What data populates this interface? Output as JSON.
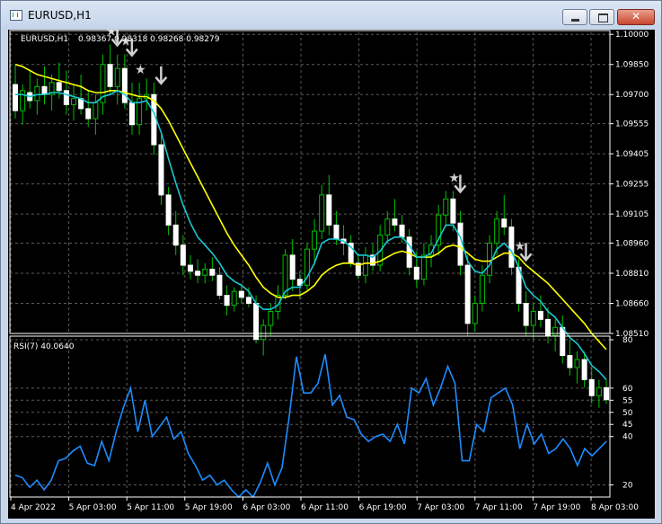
{
  "window": {
    "title": "EURUSD,H1",
    "close_glyph": "✕",
    "icons": [
      "chart-window-icon",
      "minimize-icon",
      "maximize-icon",
      "close-icon"
    ]
  },
  "colors": {
    "background": "#000000",
    "grid": "#5a5a5a",
    "bull": "#00c000",
    "ma_fast": "#19c8d2",
    "ma_slow": "#ffff00",
    "rsi": "#1e8cff",
    "arrow": "#d0d0d0",
    "text": "#ffffff"
  },
  "symbol_info": {
    "label": "EURUSD,H1",
    "values": "0.98367 0.98318 0.98268 0.98279"
  },
  "price_axis": {
    "ticks": [
      "1.10000",
      "1.09850",
      "1.09700",
      "1.09555",
      "1.09405",
      "1.09255",
      "1.09105",
      "1.08960",
      "1.08810",
      "1.08660",
      "1.08510"
    ]
  },
  "rsi_label": "RSI(7) 40.0640",
  "rsi_axis": {
    "ticks": [
      "80",
      "60",
      "55",
      "50",
      "45",
      "40",
      "20"
    ]
  },
  "time_axis": {
    "ticks": [
      "4 Apr 2022",
      "5 Apr 03:00",
      "5 Apr 11:00",
      "5 Apr 19:00",
      "6 Apr 03:00",
      "6 Apr 11:00",
      "6 Apr 19:00",
      "7 Apr 03:00",
      "7 Apr 11:00",
      "7 Apr 19:00",
      "8 Apr 03:00"
    ]
  },
  "chart_data": [
    {
      "type": "candlestick",
      "title": "EURUSD,H1",
      "x_ticks": [
        "4 Apr 2022",
        "5 Apr 03:00",
        "5 Apr 11:00",
        "5 Apr 19:00",
        "6 Apr 03:00",
        "6 Apr 11:00",
        "6 Apr 19:00",
        "7 Apr 03:00",
        "7 Apr 11:00",
        "7 Apr 19:00",
        "8 Apr 03:00"
      ],
      "ylim": [
        1.0851,
        1.1001
      ],
      "grid": true,
      "series": [
        {
          "ohlc": [
            [
              1.0975,
              1.0985,
              1.0958,
              1.0962
            ],
            [
              1.0962,
              1.0975,
              1.0955,
              1.0972
            ],
            [
              1.0971,
              1.0982,
              1.0963,
              1.0967
            ],
            [
              1.0967,
              1.0978,
              1.096,
              1.0974
            ],
            [
              1.0974,
              1.0984,
              1.0965,
              1.097
            ],
            [
              1.097,
              1.098,
              1.0962,
              1.0976
            ],
            [
              1.0976,
              1.0986,
              1.0968,
              1.0972
            ],
            [
              1.0972,
              1.0982,
              1.096,
              1.0965
            ],
            [
              1.0965,
              1.0975,
              1.0957,
              1.0968
            ],
            [
              1.0968,
              1.098,
              1.096,
              1.0963
            ],
            [
              1.0963,
              1.0972,
              1.0954,
              1.0958
            ],
            [
              1.0958,
              1.097,
              1.095,
              1.0966
            ],
            [
              1.0966,
              1.099,
              1.096,
              1.0985
            ],
            [
              1.0985,
              1.0995,
              1.097,
              1.0974
            ],
            [
              1.0974,
              1.099,
              1.0965,
              1.0983
            ],
            [
              1.0983,
              1.099,
              1.0963,
              1.0966
            ],
            [
              1.0966,
              1.0976,
              1.095,
              1.0955
            ],
            [
              1.0955,
              1.0976,
              1.095,
              1.0968
            ],
            [
              1.0968,
              1.0978,
              1.0962,
              1.097
            ],
            [
              1.097,
              1.0976,
              1.094,
              1.0945
            ],
            [
              1.0945,
              1.095,
              1.0915,
              1.092
            ],
            [
              1.092,
              1.0924,
              1.09,
              1.0905
            ],
            [
              1.0905,
              1.0912,
              1.089,
              1.0895
            ],
            [
              1.0895,
              1.09,
              1.088,
              1.0885
            ],
            [
              1.0885,
              1.089,
              1.0878,
              1.0882
            ],
            [
              1.0882,
              1.0888,
              1.0876,
              1.088
            ],
            [
              1.088,
              1.0886,
              1.0876,
              1.0883
            ],
            [
              1.0883,
              1.0889,
              1.0877,
              1.088
            ],
            [
              1.088,
              1.0884,
              1.0868,
              1.087
            ],
            [
              1.087,
              1.0875,
              1.086,
              1.0865
            ],
            [
              1.0865,
              1.0874,
              1.0862,
              1.0872
            ],
            [
              1.0872,
              1.0876,
              1.0866,
              1.0869
            ],
            [
              1.0869,
              1.0874,
              1.0864,
              1.0866
            ],
            [
              1.0866,
              1.087,
              1.0846,
              1.0848
            ],
            [
              1.0848,
              1.0858,
              1.084,
              1.0855
            ],
            [
              1.0855,
              1.0866,
              1.085,
              1.0862
            ],
            [
              1.0862,
              1.0875,
              1.0858,
              1.087
            ],
            [
              1.087,
              1.0893,
              1.0868,
              1.089
            ],
            [
              1.089,
              1.0898,
              1.0872,
              1.0878
            ],
            [
              1.0878,
              1.0882,
              1.0868,
              1.0875
            ],
            [
              1.0875,
              1.0896,
              1.0872,
              1.0893
            ],
            [
              1.0893,
              1.0908,
              1.0885,
              1.0902
            ],
            [
              1.0902,
              1.0925,
              1.0898,
              1.092
            ],
            [
              1.092,
              1.093,
              1.09,
              1.0905
            ],
            [
              1.0905,
              1.0912,
              1.0895,
              1.0898
            ],
            [
              1.0898,
              1.0905,
              1.089,
              1.0896
            ],
            [
              1.0896,
              1.09,
              1.0884,
              1.0886
            ],
            [
              1.0886,
              1.089,
              1.0878,
              1.088
            ],
            [
              1.088,
              1.0894,
              1.0876,
              1.089
            ],
            [
              1.089,
              1.0896,
              1.0882,
              1.0885
            ],
            [
              1.0885,
              1.0905,
              1.0882,
              1.09
            ],
            [
              1.09,
              1.0912,
              1.0896,
              1.0908
            ],
            [
              1.0908,
              1.0918,
              1.0902,
              1.0905
            ],
            [
              1.0905,
              1.091,
              1.0896,
              1.0899
            ],
            [
              1.0899,
              1.0903,
              1.088,
              1.0884
            ],
            [
              1.0884,
              1.0892,
              1.0874,
              1.0878
            ],
            [
              1.0878,
              1.0896,
              1.0875,
              1.089
            ],
            [
              1.089,
              1.09,
              1.0884,
              1.0895
            ],
            [
              1.0895,
              1.0915,
              1.089,
              1.091
            ],
            [
              1.091,
              1.0922,
              1.0904,
              1.0918
            ],
            [
              1.0918,
              1.0922,
              1.0902,
              1.0906
            ],
            [
              1.0906,
              1.0912,
              1.088,
              1.0885
            ],
            [
              1.0885,
              1.089,
              1.085,
              1.0856
            ],
            [
              1.0856,
              1.087,
              1.0852,
              1.0866
            ],
            [
              1.0866,
              1.0885,
              1.0862,
              1.088
            ],
            [
              1.088,
              1.09,
              1.0876,
              1.0896
            ],
            [
              1.0896,
              1.0912,
              1.089,
              1.0908
            ],
            [
              1.0908,
              1.092,
              1.09,
              1.0904
            ],
            [
              1.0904,
              1.0908,
              1.088,
              1.0884
            ],
            [
              1.0884,
              1.0888,
              1.0862,
              1.0866
            ],
            [
              1.0866,
              1.0872,
              1.085,
              1.0855
            ],
            [
              1.0855,
              1.0866,
              1.0848,
              1.0862
            ],
            [
              1.0862,
              1.087,
              1.0854,
              1.0858
            ],
            [
              1.0858,
              1.0864,
              1.0846,
              1.085
            ],
            [
              1.085,
              1.0858,
              1.0842,
              1.0854
            ],
            [
              1.0854,
              1.086,
              1.0836,
              1.084
            ],
            [
              1.084,
              1.0848,
              1.083,
              1.0834
            ],
            [
              1.0834,
              1.0842,
              1.0826,
              1.0838
            ],
            [
              1.0838,
              1.0842,
              1.0824,
              1.0828
            ],
            [
              1.0828,
              1.0834,
              1.0816,
              1.082
            ],
            [
              1.082,
              1.0828,
              1.0814,
              1.0824
            ],
            [
              1.0824,
              1.0828,
              1.0816,
              1.0818
            ]
          ]
        },
        {
          "name": "",
          "values": [
            1.097,
            1.097,
            1.0969,
            1.097,
            1.097,
            1.0971,
            1.0971,
            1.097,
            1.0969,
            1.0968,
            1.0966,
            1.0966,
            1.0969,
            1.097,
            1.0972,
            1.097,
            1.0966,
            1.0966,
            1.0967,
            1.0961,
            1.0951,
            1.0938,
            1.0926,
            1.0915,
            1.0906,
            1.0899,
            1.0895,
            1.0891,
            1.0886,
            1.088,
            1.0877,
            1.0875,
            1.0872,
            1.0866,
            1.0863,
            1.0863,
            1.0865,
            1.0872,
            1.0874,
            1.0874,
            1.0879,
            1.0886,
            1.0896,
            1.0898,
            1.0898,
            1.0897,
            1.0894,
            1.089,
            1.089,
            1.0889,
            1.0892,
            1.0897,
            1.0899,
            1.0899,
            1.0895,
            1.0889,
            1.0889,
            1.0891,
            1.0898,
            1.0905,
            1.0905,
            1.0899,
            1.0887,
            1.0882,
            1.0881,
            1.0885,
            1.0893,
            1.0896,
            1.0892,
            1.0884,
            1.0874,
            1.087,
            1.0867,
            1.0862,
            1.0859,
            1.0854,
            1.0849,
            1.0846,
            1.0841,
            1.0835,
            1.0832,
            1.0828
          ]
        },
        {
          "name": "",
          "values": [
            1.0985,
            1.0984,
            1.0982,
            1.098,
            1.0979,
            1.0978,
            1.0977,
            1.0976,
            1.0975,
            1.0974,
            1.0972,
            1.0971,
            1.0971,
            1.0972,
            1.0972,
            1.0971,
            1.097,
            1.0969,
            1.0969,
            1.0967,
            1.0963,
            1.0957,
            1.095,
            1.0943,
            1.0936,
            1.0929,
            1.0922,
            1.0915,
            1.0908,
            1.0901,
            1.0895,
            1.089,
            1.0885,
            1.0879,
            1.0874,
            1.0871,
            1.0869,
            1.0869,
            1.087,
            1.087,
            1.0872,
            1.0875,
            1.088,
            1.0883,
            1.0885,
            1.0886,
            1.0886,
            1.0885,
            1.0886,
            1.0886,
            1.0887,
            1.0889,
            1.0891,
            1.0892,
            1.0891,
            1.0889,
            1.0889,
            1.0889,
            1.0891,
            1.0894,
            1.0895,
            1.0894,
            1.0891,
            1.0888,
            1.0887,
            1.0887,
            1.0889,
            1.0891,
            1.0891,
            1.0889,
            1.0885,
            1.0882,
            1.0879,
            1.0876,
            1.0872,
            1.0868,
            1.0864,
            1.086,
            1.0856,
            1.0851,
            1.0847,
            1.0843
          ]
        }
      ],
      "markers": [
        {
          "type": "star-down-arrow",
          "x_index": 13
        },
        {
          "type": "star-down-arrow",
          "x_index": 15
        },
        {
          "type": "star",
          "x_index": 17
        },
        {
          "type": "down-arrow",
          "x_index": 19
        },
        {
          "type": "star-down-arrow",
          "x_index": 60
        },
        {
          "type": "star-down-arrow",
          "x_index": 69
        }
      ]
    },
    {
      "type": "line",
      "title": "RSI(7) 40.0640",
      "ylim": [
        15,
        80
      ],
      "y_ticks": [
        80,
        60,
        55,
        50,
        45,
        40,
        20
      ],
      "grid": true,
      "series": [
        {
          "name": "",
          "values": [
            24,
            23,
            19,
            22,
            18,
            22,
            30,
            31,
            34,
            36,
            29,
            28,
            38,
            30,
            42,
            52,
            60,
            42,
            55,
            40,
            44,
            48,
            39,
            42,
            33,
            28,
            22,
            24,
            20,
            22,
            18,
            15,
            18,
            15,
            21,
            29,
            20,
            27,
            48,
            73,
            58,
            58,
            62,
            74,
            53,
            57,
            48,
            47,
            41,
            38,
            40,
            41,
            38,
            45,
            37,
            60,
            58,
            64,
            53,
            60,
            69,
            62,
            30,
            30,
            45,
            42,
            56,
            58,
            60,
            53,
            35,
            45,
            37,
            41,
            33,
            35,
            39,
            35,
            28,
            35,
            32,
            35,
            38
          ]
        }
      ]
    }
  ]
}
